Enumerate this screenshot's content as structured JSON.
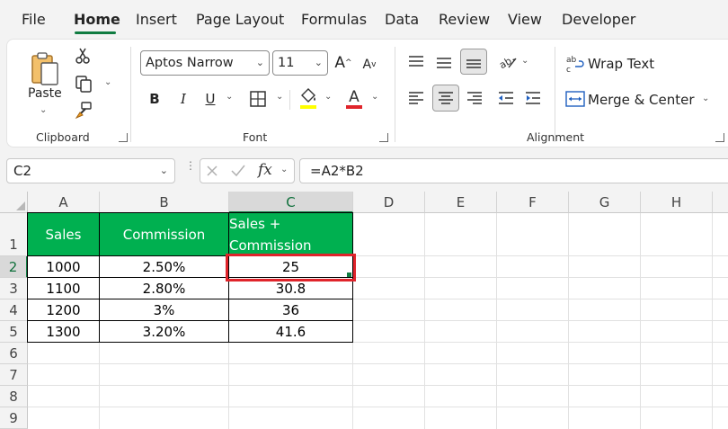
{
  "menu": {
    "tabs": [
      {
        "label": "File"
      },
      {
        "label": "Home"
      },
      {
        "label": "Insert"
      },
      {
        "label": "Page Layout"
      },
      {
        "label": "Formulas"
      },
      {
        "label": "Data"
      },
      {
        "label": "Review"
      },
      {
        "label": "View"
      },
      {
        "label": "Developer"
      }
    ],
    "active": "Home"
  },
  "ribbon": {
    "clipboard": {
      "group_label": "Clipboard",
      "paste_label": "Paste"
    },
    "font": {
      "group_label": "Font",
      "font_name": "Aptos Narrow",
      "font_size": "11",
      "bold": "B",
      "italic": "I",
      "underline": "U",
      "font_color": "#e0242b",
      "fill_color": "#ffff00"
    },
    "alignment": {
      "group_label": "Alignment",
      "wrap_text": "Wrap Text",
      "merge_center": "Merge & Center"
    }
  },
  "formula_bar": {
    "name_box": "C2",
    "formula": "=A2*B2"
  },
  "sheet": {
    "columns": [
      "A",
      "B",
      "C",
      "D",
      "E",
      "F",
      "G",
      "H"
    ],
    "rows": [
      "1",
      "2",
      "3",
      "4",
      "5",
      "6",
      "7",
      "8",
      "9"
    ],
    "selected_cell": "C2",
    "header_color": "#00b050",
    "highlight_color": "#e0242b",
    "table": {
      "headers": [
        "Sales",
        "Commission",
        "Sales + Commission"
      ],
      "header_c_lines": [
        "Sales +",
        "Commission"
      ],
      "rows": [
        [
          "1000",
          "2.50%",
          "25"
        ],
        [
          "1100",
          "2.80%",
          "30.8"
        ],
        [
          "1200",
          "3%",
          "36"
        ],
        [
          "1300",
          "3.20%",
          "41.6"
        ]
      ]
    }
  }
}
